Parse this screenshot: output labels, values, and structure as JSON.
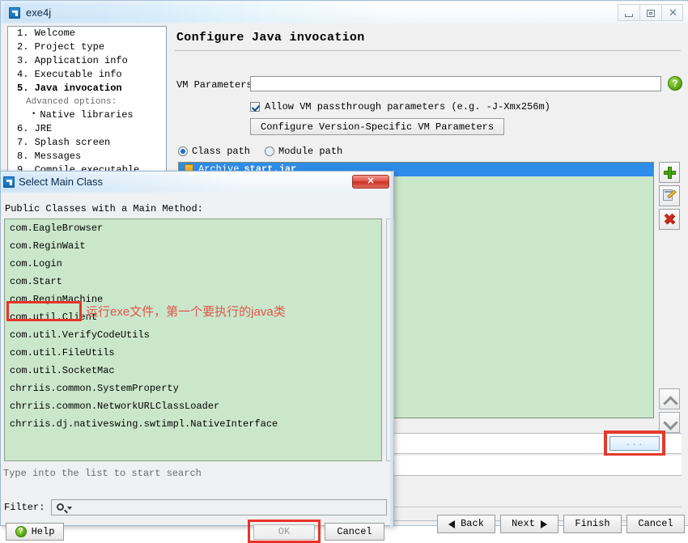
{
  "window": {
    "title": "exe4j",
    "icon": "exe4j-icon",
    "buttons": {
      "minimize": "minimize-icon",
      "maximize": "maximize-icon",
      "close": "✕"
    }
  },
  "sidebar": {
    "items": [
      {
        "label": "1. Welcome",
        "type": "step"
      },
      {
        "label": "2. Project type",
        "type": "step"
      },
      {
        "label": "3. Application info",
        "type": "step"
      },
      {
        "label": "4. Executable info",
        "type": "step"
      },
      {
        "label": "5. Java invocation",
        "type": "step",
        "active": true
      },
      {
        "label": "Advanced options:",
        "type": "group"
      },
      {
        "label": "Native libraries",
        "type": "bullet"
      },
      {
        "label": "6. JRE",
        "type": "step"
      },
      {
        "label": "7. Splash screen",
        "type": "step"
      },
      {
        "label": "8. Messages",
        "type": "step"
      },
      {
        "label": "9. Compile executable",
        "type": "step"
      }
    ]
  },
  "main": {
    "title": "Configure Java invocation",
    "vm_parameters_label": "VM Parameters:",
    "vm_parameters_value": "",
    "help_icon": "?",
    "passthrough_label": "Allow VM passthrough parameters (e.g. -J-Xmx256m)",
    "passthrough_checked": true,
    "version_specific_button": "Configure Version-Specific VM Parameters",
    "path_mode": [
      {
        "label": "Class path",
        "selected": true
      },
      {
        "label": "Module path",
        "selected": false
      }
    ],
    "classpath_entries": [
      {
        "kind": "Archive",
        "name": "start.jar",
        "selected": true
      }
    ],
    "tools": [
      {
        "name": "add-entry-button",
        "icon": "plus-icon"
      },
      {
        "name": "edit-entry-button",
        "icon": "pencil-icon"
      },
      {
        "name": "delete-entry-button",
        "icon": "red-x-icon"
      }
    ],
    "reorder": [
      {
        "name": "move-up-button",
        "icon": "chevron-up-icon"
      },
      {
        "name": "move-down-button",
        "icon": "chevron-down-icon"
      }
    ],
    "main_class_value": "",
    "browse_button": "...",
    "arguments_value": "",
    "wizard_buttons": [
      {
        "label": "Back",
        "arrow": "left"
      },
      {
        "label": "Next",
        "arrow": "right"
      },
      {
        "label": "Finish",
        "arrow": "none"
      },
      {
        "label": "Cancel",
        "arrow": "none"
      }
    ]
  },
  "dialog": {
    "title": "Select Main Class",
    "icon": "exe4j-icon",
    "close_label": "✕",
    "list_label": "Public Classes with a Main Method:",
    "classes": [
      "com.EagleBrowser",
      "com.ReginWait",
      "com.Login",
      "com.Start",
      "com.ReginMachine",
      "com.util.Client",
      "com.util.VerifyCodeUtils",
      "com.util.FileUtils",
      "com.util.SocketMac",
      "chrriis.common.SystemProperty",
      "chrriis.common.NetworkURLClassLoader",
      "chrriis.dj.nativeswing.swtimpl.NativeInterface"
    ],
    "highlighted_class": "com.Login",
    "annotation": "运行exe文件，第一个要执行的java类",
    "hint": "Type into the list to start search",
    "filter_label": "Filter:",
    "filter_value": "",
    "filter_icon": "search-icon",
    "buttons": {
      "help": "Help",
      "ok": "OK",
      "cancel": "Cancel"
    }
  },
  "colors": {
    "accent_blue": "#2f8ce8",
    "list_green": "#cbe7cb",
    "highlight_red": "#e8332a",
    "annotation_red": "#e0554b"
  }
}
